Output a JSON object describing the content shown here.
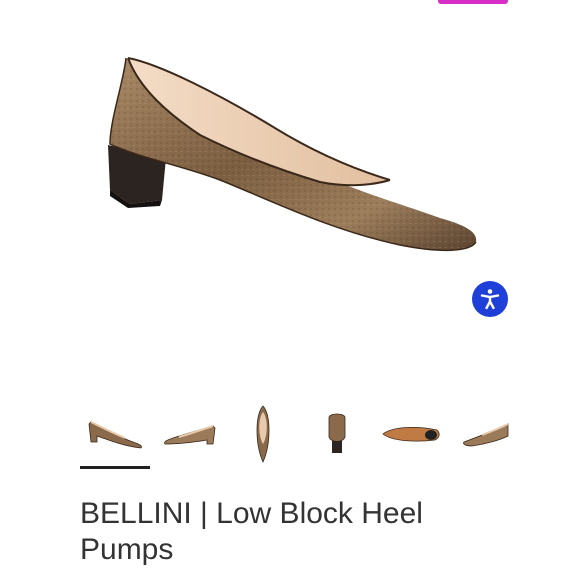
{
  "product": {
    "title": "BELLINI | Low Block Heel Pumps",
    "active_thumbnail": 1
  },
  "thumbnails": [
    {
      "view": "side-left"
    },
    {
      "view": "side-right"
    },
    {
      "view": "top"
    },
    {
      "view": "back"
    },
    {
      "view": "sole"
    },
    {
      "view": "side-partial"
    }
  ],
  "colors": {
    "accent_tab": "#d62ec6",
    "accessibility_button": "#1e3fd8",
    "shoe_metallic": "#8a6a4a",
    "lining": "#e8c9ad",
    "heel": "#2b2420"
  },
  "icons": {
    "accessibility": "accessibility-person-icon"
  }
}
